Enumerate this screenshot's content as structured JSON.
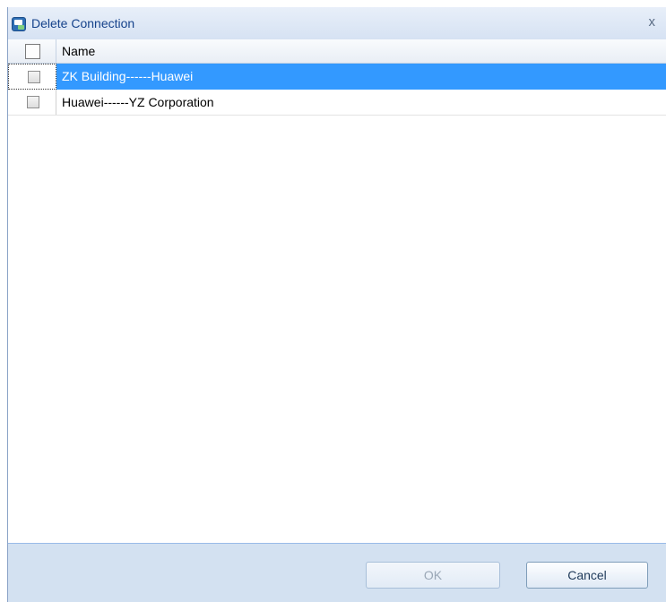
{
  "dialog": {
    "title": "Delete Connection",
    "close_label": "x"
  },
  "grid": {
    "column_header": "Name",
    "rows": [
      {
        "name": "ZK Building------Huawei",
        "selected": true,
        "checked": false
      },
      {
        "name": "Huawei------YZ Corporation",
        "selected": false,
        "checked": false
      }
    ]
  },
  "buttons": {
    "ok_label": "OK",
    "ok_enabled": false,
    "cancel_label": "Cancel"
  },
  "colors": {
    "selection": "#3399ff",
    "title_text": "#15428b",
    "footer_bg": "#d3e1f1"
  }
}
